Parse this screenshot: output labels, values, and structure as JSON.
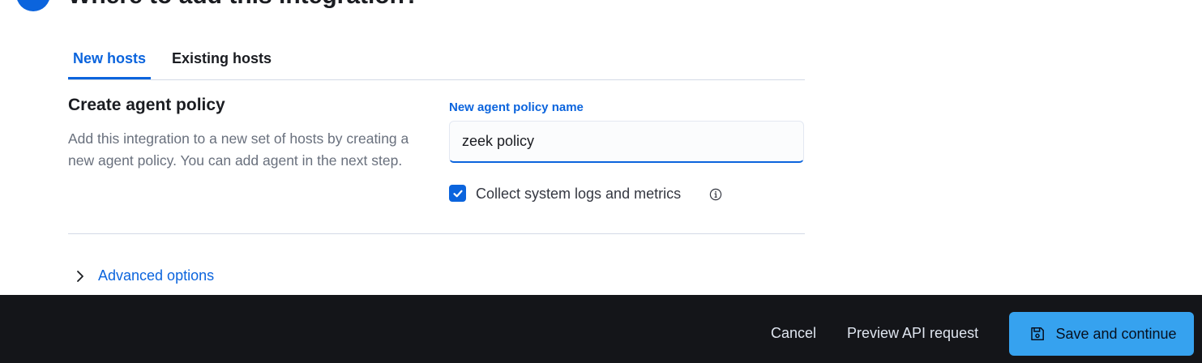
{
  "step": {
    "title": "Where to add this integration?"
  },
  "tabs": [
    {
      "label": "New hosts",
      "active": true
    },
    {
      "label": "Existing hosts",
      "active": false
    }
  ],
  "policy_section": {
    "title": "Create agent policy",
    "description": "Add this integration to a new set of hosts by creating a new agent policy. You can add agent in the next step."
  },
  "form": {
    "name_label": "New agent policy name",
    "name_value": "zeek policy",
    "collect_label": "Collect system logs and metrics",
    "collect_checked": true,
    "info_icon": "info-icon"
  },
  "advanced": {
    "label": "Advanced options",
    "icon": "chevron-right-icon"
  },
  "bottom_bar": {
    "cancel_label": "Cancel",
    "preview_label": "Preview API request",
    "save_label": "Save and continue",
    "save_icon": "save-icon"
  },
  "colors": {
    "accent": "#0b64dd",
    "save_button": "#36a2ef",
    "bottom_bar": "#141519"
  }
}
